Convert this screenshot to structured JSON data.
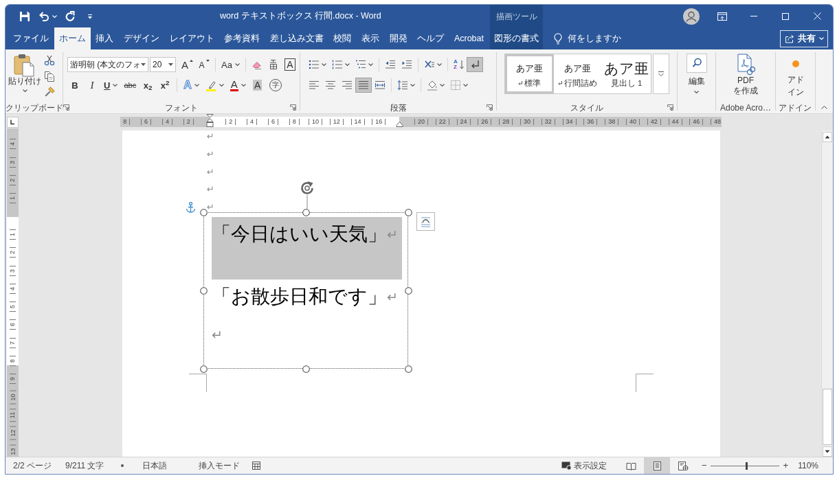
{
  "window": {
    "title": "word テキストボックス 行間.docx - Word",
    "contextual_header": "描画ツール"
  },
  "tabs": [
    {
      "label": "ファイル",
      "selected": false,
      "contextual": false
    },
    {
      "label": "ホーム",
      "selected": true,
      "contextual": false
    },
    {
      "label": "挿入",
      "selected": false,
      "contextual": false
    },
    {
      "label": "デザイン",
      "selected": false,
      "contextual": false
    },
    {
      "label": "レイアウト",
      "selected": false,
      "contextual": false
    },
    {
      "label": "参考資料",
      "selected": false,
      "contextual": false
    },
    {
      "label": "差し込み文書",
      "selected": false,
      "contextual": false
    },
    {
      "label": "校閲",
      "selected": false,
      "contextual": false
    },
    {
      "label": "表示",
      "selected": false,
      "contextual": false
    },
    {
      "label": "開発",
      "selected": false,
      "contextual": false
    },
    {
      "label": "ヘルプ",
      "selected": false,
      "contextual": false
    },
    {
      "label": "Acrobat",
      "selected": false,
      "contextual": false
    },
    {
      "label": "図形の書式",
      "selected": false,
      "contextual": true
    }
  ],
  "tell_me": {
    "placeholder": "何をしますか"
  },
  "share": {
    "label": "共有"
  },
  "ribbon": {
    "clipboard": {
      "label": "クリップボード",
      "paste": "貼り付け"
    },
    "font": {
      "label": "フォント",
      "font_name": "游明朝 (本文のフォ",
      "font_size": "20",
      "row1": [
        [
          {
            "kind": "grow",
            "text": "A"
          },
          {
            "kind": "shrink",
            "text": "A"
          }
        ],
        [
          {
            "kind": "case",
            "text": "Aa",
            "caret": true
          }
        ],
        [
          {
            "kind": "clear"
          },
          {
            "kind": "ruby"
          },
          {
            "kind": "border",
            "text": "A"
          }
        ]
      ],
      "row2": [
        [
          {
            "kind": "bold",
            "text": "B"
          },
          {
            "kind": "italic",
            "text": "I"
          },
          {
            "kind": "underline",
            "text": "U",
            "caret": true
          },
          {
            "kind": "strike",
            "text": "abc"
          },
          {
            "kind": "sub",
            "text": "x$_{2}$"
          },
          {
            "kind": "sup",
            "text": "x$^{2}$"
          }
        ],
        [
          {
            "kind": "effects",
            "text": "A",
            "caret": true
          },
          {
            "kind": "highlight",
            "caret": true
          },
          {
            "kind": "color",
            "text": "A",
            "caret": true
          },
          {
            "kind": "shading",
            "text": "A"
          },
          {
            "kind": "enclose",
            "text": "字"
          }
        ]
      ]
    },
    "paragraph": {
      "label": "段落",
      "row1": [
        [
          {
            "kind": "bullets",
            "caret": true
          },
          {
            "kind": "numbering",
            "caret": true
          },
          {
            "kind": "multilevel",
            "caret": true
          }
        ],
        [
          {
            "kind": "outdent"
          },
          {
            "kind": "indent"
          }
        ],
        [
          {
            "kind": "asian",
            "caret": true
          }
        ],
        [
          {
            "kind": "sort",
            "top": "A",
            "bottom": "Z"
          },
          {
            "kind": "marks",
            "on": true
          }
        ]
      ],
      "row2": [
        [
          {
            "kind": "left",
            "selected": false
          },
          {
            "kind": "center",
            "selected": false
          },
          {
            "kind": "right",
            "selected": false
          },
          {
            "kind": "justify",
            "selected": true
          },
          {
            "kind": "distribute",
            "selected": false
          }
        ],
        [
          {
            "kind": "spacing",
            "caret": true
          }
        ],
        [
          {
            "kind": "shading",
            "caret": true
          },
          {
            "kind": "borders",
            "caret": true
          }
        ]
      ]
    },
    "styles": {
      "label": "スタイル",
      "items": [
        {
          "preview": "あア亜",
          "name": "標準",
          "kind": "body",
          "paragraph_mark": true,
          "selected": true
        },
        {
          "preview": "あア亜",
          "name": "行間詰め",
          "kind": "body",
          "paragraph_mark": true,
          "selected": false
        },
        {
          "preview": "あア亜",
          "name": "見出し 1",
          "kind": "heading",
          "selected": false
        }
      ]
    },
    "editing": {
      "button": "編集"
    },
    "adobe": {
      "lines": [
        "PDF",
        "を作成"
      ],
      "label": "Adobe Acro…"
    },
    "addins": {
      "lines": [
        "アド",
        "イン"
      ],
      "label": "アドイン"
    }
  },
  "ruler": {
    "left_margin_labels": [
      "8",
      "6",
      "4",
      "2"
    ],
    "text_labels": [
      "2",
      "4",
      "6",
      "8",
      "10",
      "12",
      "14",
      "16"
    ],
    "right_margin_labels": [
      "20",
      "22",
      "24",
      "26",
      "28",
      "30",
      "32",
      "34",
      "36",
      "38",
      "40",
      "42",
      "44",
      "46",
      "48"
    ]
  },
  "vertical_ruler": {
    "top_margin_labels": [
      "4",
      "3",
      "2",
      "1"
    ],
    "labels": [
      "1",
      "2",
      "3",
      "4",
      "5",
      "6",
      "7",
      "8",
      "9",
      "10",
      "11",
      "12",
      "13"
    ]
  },
  "document": {
    "paragraph_marks": [
      "↵",
      "↵",
      "↵",
      "↵",
      "↵"
    ],
    "text_box": {
      "paragraphs": [
        {
          "text": "「今日はいい天気」",
          "mark": "↵",
          "selected": true
        },
        {
          "text": "「お散歩日和です」",
          "mark": "↵",
          "selected": false
        },
        {
          "mark": "↵",
          "selected": false
        }
      ]
    }
  },
  "status_bar": {
    "page": "2/2 ページ",
    "words": "9/211 文字",
    "language": "日本語",
    "mode": "挿入モード",
    "display_settings": "表示設定",
    "views": [
      {
        "kind": "read",
        "selected": false
      },
      {
        "kind": "print",
        "selected": true
      },
      {
        "kind": "web",
        "selected": false
      }
    ],
    "zoom": {
      "minus": "−",
      "plus": "+",
      "level": 0.53,
      "reading": "110%"
    }
  }
}
